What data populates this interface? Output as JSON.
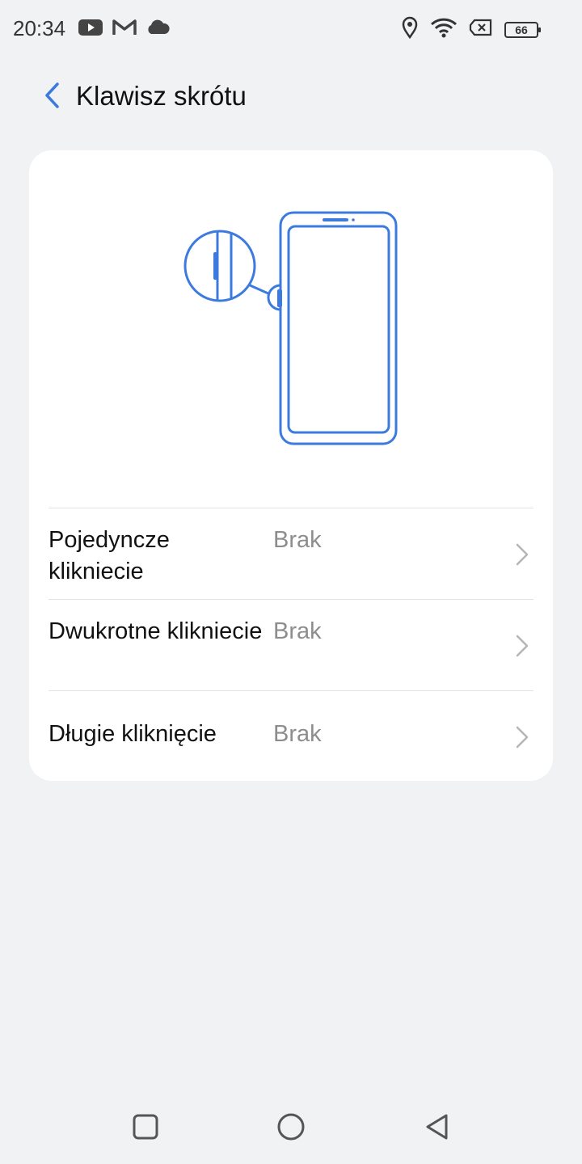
{
  "status_bar": {
    "time": "20:34",
    "left_icons": [
      "youtube-icon",
      "gmail-icon",
      "cloud-icon"
    ],
    "right_icons": [
      "location-icon",
      "wifi-icon",
      "sim-off-icon"
    ],
    "battery_level": "66"
  },
  "header": {
    "title": "Klawisz skrótu"
  },
  "settings": [
    {
      "label": "Pojedyncze klikniecie",
      "value": "Brak"
    },
    {
      "label": "Dwukrotne klikniecie",
      "value": "Brak"
    },
    {
      "label": "Długie kliknięcie",
      "value": "Brak"
    }
  ],
  "colors": {
    "accent": "#3b7be0",
    "background": "#f1f2f4",
    "card": "#ffffff",
    "secondary_text": "#8d8d8f"
  },
  "nav_bar": {
    "icons": [
      "recent-apps-icon",
      "home-icon",
      "back-icon"
    ]
  }
}
